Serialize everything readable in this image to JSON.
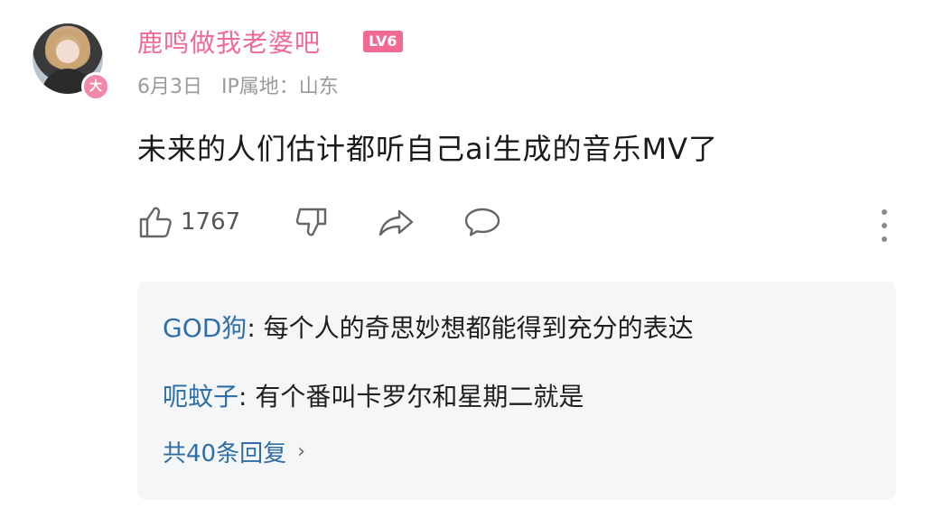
{
  "author": {
    "name": "鹿鸣做我老婆吧",
    "level": "LV6",
    "badge_char": "大",
    "date": "6月3日",
    "ip_label": "IP属地：山东"
  },
  "post": {
    "text": "未来的人们估计都听自己ai生成的音乐MV了",
    "likes": "1767"
  },
  "icons": {
    "like": "thumbs-up-icon",
    "dislike": "thumbs-down-icon",
    "share": "share-icon",
    "comment": "comment-icon",
    "more": "more-vertical-icon"
  },
  "replies": [
    {
      "name": "GOD狗",
      "text": "每个人的奇思妙想都能得到充分的表达"
    },
    {
      "name": "呃蚊子",
      "text": "有个番叫卡罗尔和星期二就是"
    }
  ],
  "more_replies_label": "共40条回复",
  "colors": {
    "accent_pink": "#f06a93",
    "reply_name_blue": "#2f6ea8",
    "reply_bg": "#f5f6f8"
  }
}
